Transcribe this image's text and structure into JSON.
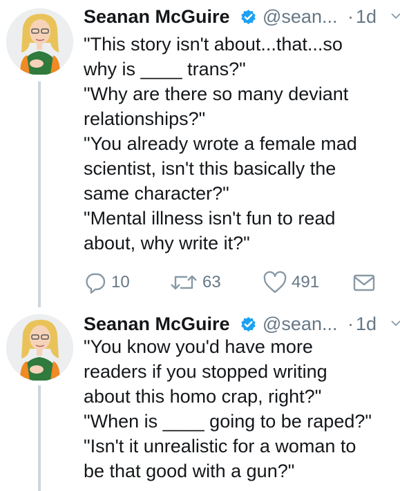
{
  "tweets": [
    {
      "author_name": "Seanan McGuire",
      "handle": "@sean...",
      "separator": "·",
      "time": "1d",
      "lines": [
        "\"This story isn't about...that...so",
        "why is ____ trans?\"",
        "\"Why are there so many deviant",
        "relationships?\"",
        "\"You already wrote a female mad",
        "scientist, isn't this basically the",
        "same character?\"",
        "\"Mental illness isn't fun to read",
        "about, why write it?\""
      ],
      "replies": "10",
      "retweets": "63",
      "likes": "491"
    },
    {
      "author_name": "Seanan McGuire",
      "handle": "@sean...",
      "separator": "·",
      "time": "1d",
      "lines": [
        "\"You know you'd have more",
        "readers if you stopped writing",
        "about this homo crap, right?\"",
        "\"When is ____ going to be raped?\"",
        "\"Isn't it unrealistic for a woman to",
        "be that good with a gun?\""
      ]
    }
  ],
  "icons": {
    "verified": "verified-badge-icon",
    "caret": "chevron-down-icon",
    "reply": "reply-icon",
    "retweet": "retweet-icon",
    "like": "heart-icon",
    "dm": "envelope-icon"
  },
  "colors": {
    "text": "#14171a",
    "secondary": "#657786",
    "verified": "#1da1f2",
    "thread_line": "#cdd6dd"
  }
}
